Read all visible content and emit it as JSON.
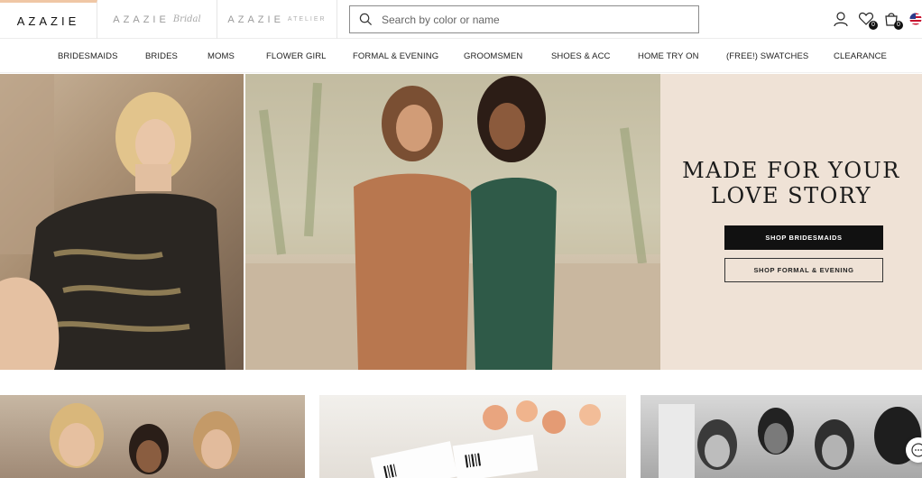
{
  "brands": {
    "main": "AZAZIE",
    "bridal": "AZAZIE",
    "bridal_script": "Bridal",
    "atelier": "AZAZIE",
    "atelier_suffix": "ATELIER"
  },
  "search": {
    "placeholder": "Search by color or name"
  },
  "header_icons": {
    "wishlist_count": "0",
    "cart_count": "0"
  },
  "nav": [
    "BRIDESMAIDS",
    "BRIDES",
    "MOMS",
    "FLOWER GIRL",
    "FORMAL & EVENING",
    "GROOMSMEN",
    "SHOES & ACC",
    "HOME TRY ON",
    "(FREE!) SWATCHES",
    "CLEARANCE"
  ],
  "hero": {
    "title_line1": "MADE FOR YOUR",
    "title_line2": "LOVE STORY",
    "primary_button": "SHOP BRIDESMAIDS",
    "secondary_button": "SHOP FORMAL & EVENING"
  },
  "colors": {
    "accent_tab": "#f0c7a5",
    "hero_panel": "#efe2d6",
    "dark": "#111111"
  }
}
